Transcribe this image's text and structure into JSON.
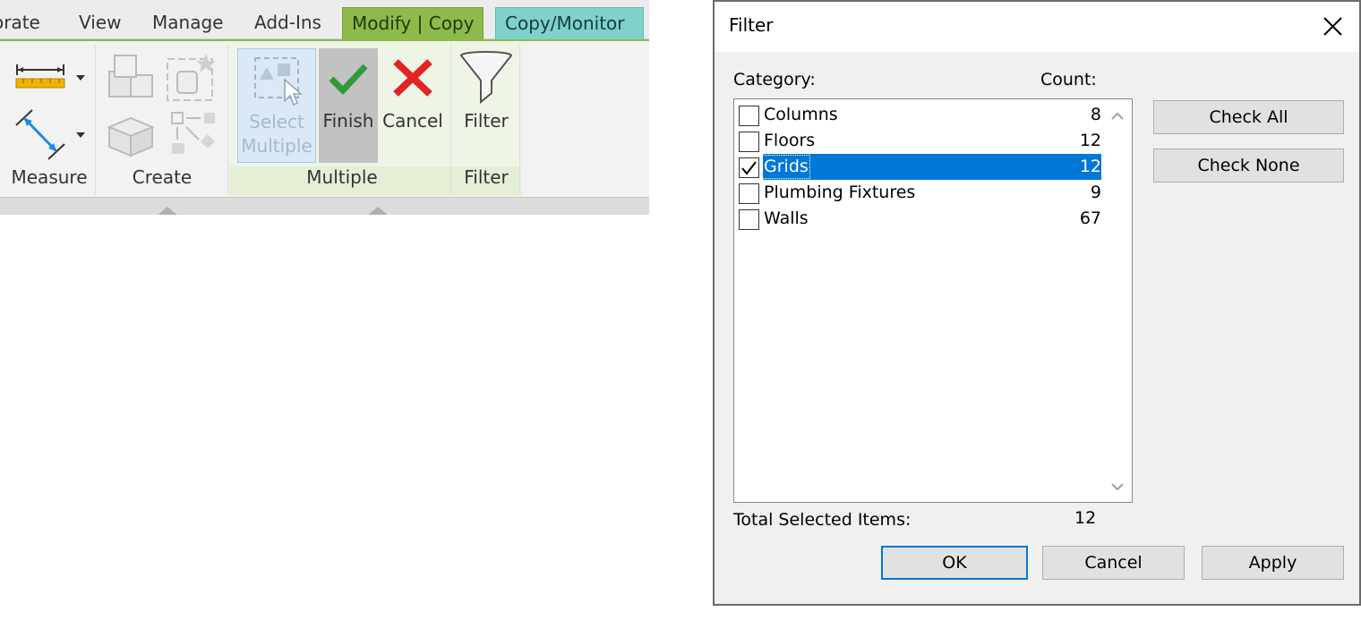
{
  "ribbon": {
    "tabs": [
      "orate",
      "View",
      "Manage",
      "Add-Ins",
      "Modify | Copy",
      "Copy/Monitor"
    ],
    "panels": {
      "measure": "Measure",
      "create": "Create",
      "multiple": "Multiple",
      "filter": "Filter"
    },
    "buttons": {
      "select_multiple_line1": "Select",
      "select_multiple_line2": "Multiple",
      "finish": "Finish",
      "cancel": "Cancel",
      "filter": "Filter"
    },
    "icons": [
      "measure-dimension-icon",
      "align-dimension-icon",
      "copy-blocks-icon",
      "create-element-icon",
      "stacked-panels-icon",
      "array-icon",
      "select-multiple-icon",
      "checkmark-icon",
      "red-x-icon",
      "funnel-icon"
    ],
    "colors": {
      "modify_tab": "#8dba4a",
      "copymonitor_tab": "#7fd1c9",
      "finish_check": "#2e9a3c",
      "cancel_x": "#e02424"
    }
  },
  "dialog": {
    "title": "Filter",
    "category_header": "Category:",
    "count_header": "Count:",
    "items": [
      {
        "name": "Columns",
        "count": "8",
        "checked": false,
        "selected": false
      },
      {
        "name": "Floors",
        "count": "12",
        "checked": false,
        "selected": false
      },
      {
        "name": "Grids",
        "count": "12",
        "checked": true,
        "selected": true
      },
      {
        "name": "Plumbing Fixtures",
        "count": "9",
        "checked": false,
        "selected": false
      },
      {
        "name": "Walls",
        "count": "67",
        "checked": false,
        "selected": false
      }
    ],
    "check_all": "Check All",
    "check_none": "Check None",
    "total_label": "Total Selected Items:",
    "total_value": "12",
    "ok": "OK",
    "cancel": "Cancel",
    "apply": "Apply",
    "colors": {
      "selection": "#0078d7"
    }
  }
}
